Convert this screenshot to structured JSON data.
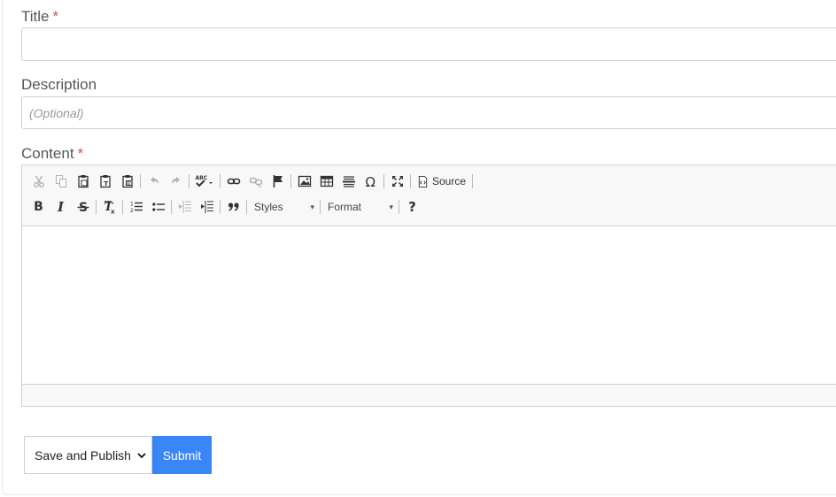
{
  "form": {
    "title_label": "Title",
    "required_mark": "*",
    "title_value": "",
    "description_label": "Description",
    "description_placeholder": "(Optional)",
    "content_label": "Content"
  },
  "editor": {
    "source_label": "Source",
    "styles_label": "Styles",
    "format_label": "Format",
    "help_label": "?",
    "combo_arrow": "▾"
  },
  "actions": {
    "publish_option": "Save and Publish",
    "submit_label": "Submit"
  },
  "colors": {
    "accent": "#3b86f7",
    "required": "#d9534f"
  }
}
